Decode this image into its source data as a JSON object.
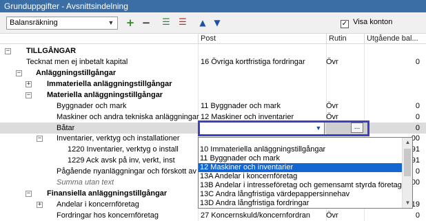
{
  "window": {
    "title": "Grunduppgifter - Avsnittsindelning"
  },
  "toolbar": {
    "combo_value": "Balansräkning",
    "checkbox_label": "Visa konton",
    "checkbox_checked": "✓"
  },
  "columns": {
    "post": "Post",
    "rutin": "Rutin",
    "utg": "Utgående bal..."
  },
  "rows": [
    {
      "name": "TILLGÅNGAR",
      "post": "",
      "rutin": "",
      "utg": ""
    },
    {
      "name": "Tecknat men ej inbetalt kapital",
      "post": "16 Övriga kortfristiga fordringar",
      "rutin": "Övr",
      "utg": "0"
    },
    {
      "name": "Anläggningstillgångar",
      "post": "",
      "rutin": "",
      "utg": ""
    },
    {
      "name": "Immateriella anläggningstillgångar",
      "post": "",
      "rutin": "",
      "utg": ""
    },
    {
      "name": "Materiella anläggningstillgångar",
      "post": "",
      "rutin": "",
      "utg": ""
    },
    {
      "name": "Byggnader och mark",
      "post": "11 Byggnader och mark",
      "rutin": "Övr",
      "utg": "0"
    },
    {
      "name": "Maskiner och andra tekniska anläggningar",
      "post": "12 Maskiner och inventarier",
      "rutin": "Övr",
      "utg": "0"
    },
    {
      "name": "Båtar",
      "post": "",
      "rutin": "",
      "utg": "0"
    },
    {
      "name": "Inventarier, verktyg och installationer",
      "post": "",
      "rutin": "",
      "utg": "00"
    },
    {
      "name": "1220 Inventarier, verktyg o install",
      "post": "",
      "rutin": "",
      "utg": "91"
    },
    {
      "name": "1229 Ack avsk på  inv, verkt, inst",
      "post": "",
      "rutin": "",
      "utg": "91"
    },
    {
      "name": "Pågående nyanläggningar och förskott av",
      "post": "",
      "rutin": "",
      "utg": "0"
    },
    {
      "name": "Summa utan text",
      "post": "",
      "rutin": "",
      "utg": "00"
    },
    {
      "name": "Finansiella anläggningstillgångar",
      "post": "",
      "rutin": "",
      "utg": ""
    },
    {
      "name": "Andelar i koncernföretag",
      "post": "",
      "rutin": "",
      "utg": "19"
    },
    {
      "name": "Fordringar hos koncernföretag",
      "post": "27 Koncernskuld/koncernfordran",
      "rutin": "Övr",
      "utg": "0"
    }
  ],
  "edit": {
    "value": "",
    "dots": "..."
  },
  "dropdown": {
    "items": [
      "10 Immateriella anläggningstillgångar",
      "11 Byggnader och mark",
      "12 Maskiner och inventarier",
      "13A Andelar i koncernföretag",
      "13B Andelar i intresseföretag och gemensamt styrda företag",
      "13C Andra långfristiga värdepappersinnehav",
      "13D Andra långfristiga fordringar"
    ],
    "selected": "12 Maskiner och inventarier"
  },
  "icons": [
    "add-icon",
    "remove-icon",
    "move-right-icon",
    "move-left-icon",
    "sort-up-icon",
    "sort-down-icon"
  ],
  "colors": {
    "titlebar": "#3b6ea5",
    "selection": "#1466d2",
    "edit_highlight": "#3d40c7"
  }
}
